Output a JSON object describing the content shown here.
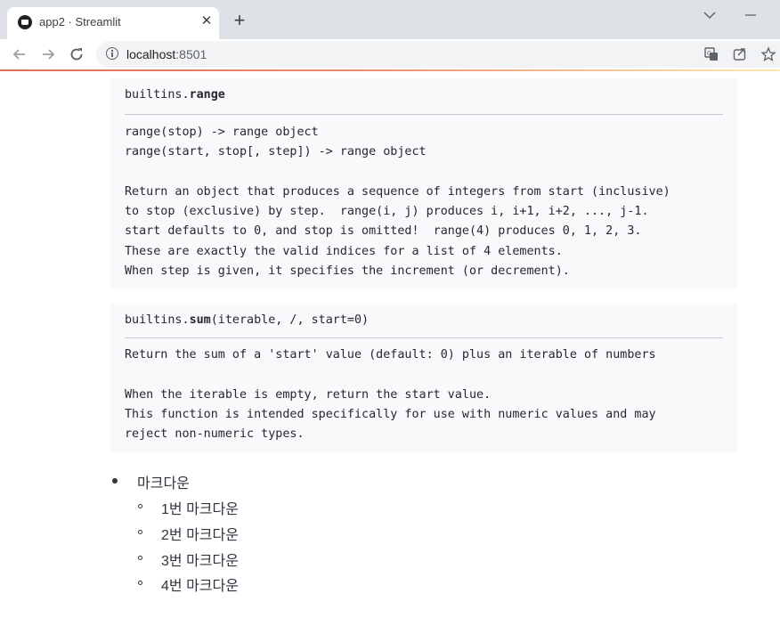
{
  "browser": {
    "tab_title": "app2 · Streamlit",
    "tab_close": "✕",
    "new_tab": "+",
    "url_host": "localhost",
    "url_port": ":8501"
  },
  "docs": [
    {
      "module": "builtins.",
      "function": "range",
      "params": "",
      "body": "range(stop) -> range object\nrange(start, stop[, step]) -> range object\n\nReturn an object that produces a sequence of integers from start (inclusive)\nto stop (exclusive) by step.  range(i, j) produces i, i+1, i+2, ..., j-1.\nstart defaults to 0, and stop is omitted!  range(4) produces 0, 1, 2, 3.\nThese are exactly the valid indices for a list of 4 elements.\nWhen step is given, it specifies the increment (or decrement)."
    },
    {
      "module": "builtins.",
      "function": "sum",
      "params": "(iterable, /, start=0)",
      "body": "Return the sum of a 'start' value (default: 0) plus an iterable of numbers\n\nWhen the iterable is empty, return the start value.\nThis function is intended specifically for use with numeric values and may\nreject non-numeric types."
    }
  ],
  "markdown": {
    "item": "마크다운",
    "subitems": [
      "1번 마크다운",
      "2번 마크다운",
      "3번 마크다운",
      "4번 마크다운"
    ]
  }
}
